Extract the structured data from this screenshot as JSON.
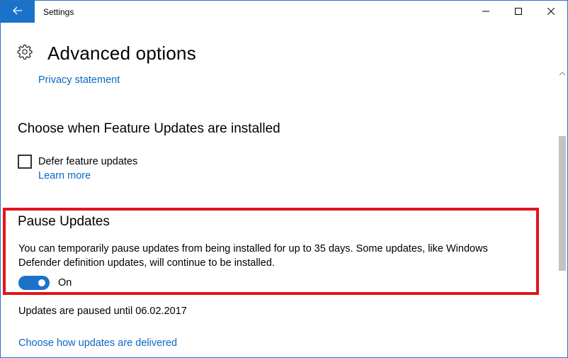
{
  "window": {
    "title": "Settings",
    "accent_color": "#1a73c9"
  },
  "header": {
    "title": "Advanced options",
    "icon": "gear-icon"
  },
  "links": {
    "privacy": "Privacy statement",
    "learn_more": "Learn more",
    "delivery": "Choose how updates are delivered"
  },
  "feature_updates": {
    "heading": "Choose when Feature Updates are installed",
    "defer_label": "Defer feature updates",
    "defer_checked": false
  },
  "pause_updates": {
    "heading": "Pause Updates",
    "description": "You can temporarily pause updates from being installed for up to 35 days. Some updates, like Windows Defender definition updates, will continue to be installed.",
    "toggle_state": "On",
    "highlight_color": "#e1141b"
  },
  "status": {
    "paused_until": "Updates are paused until 06.02.2017"
  }
}
